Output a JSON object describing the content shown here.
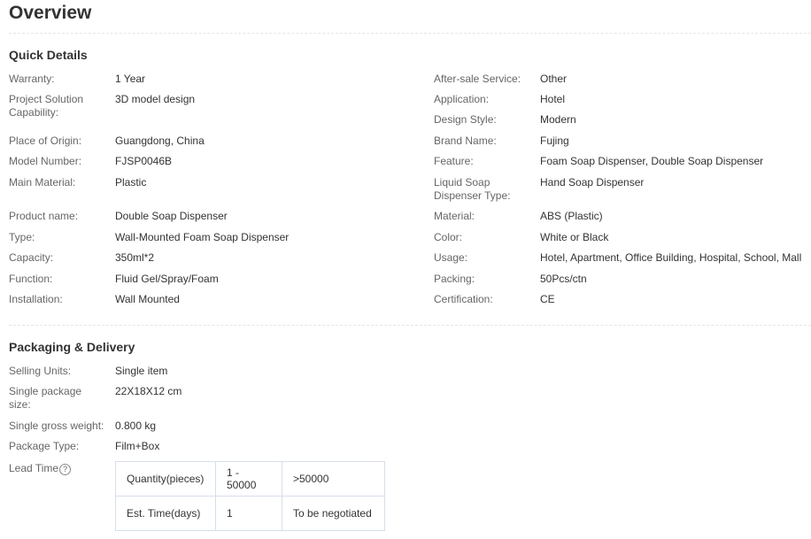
{
  "page": {
    "title": "Overview"
  },
  "quick_details": {
    "heading": "Quick Details",
    "left": [
      {
        "label": "Warranty:",
        "value": "1 Year"
      },
      {
        "label": "Project Solution Capability:",
        "value": "3D model design"
      },
      {
        "label": "Place of Origin:",
        "value": "Guangdong, China"
      },
      {
        "label": "Model Number:",
        "value": "FJSP0046B"
      },
      {
        "label": "Main Material:",
        "value": "Plastic"
      },
      {
        "label": "Product name:",
        "value": "Double Soap Dispenser"
      },
      {
        "label": "Type:",
        "value": "Wall-Mounted Foam Soap Dispenser"
      },
      {
        "label": "Capacity:",
        "value": "350ml*2"
      },
      {
        "label": "Function:",
        "value": "Fluid Gel/Spray/Foam"
      },
      {
        "label": "Installation:",
        "value": "Wall Mounted"
      }
    ],
    "right": [
      {
        "label": "After-sale Service:",
        "value": "Other"
      },
      {
        "label": "Application:",
        "value": "Hotel"
      },
      {
        "label": "Design Style:",
        "value": "Modern"
      },
      {
        "label": "Brand Name:",
        "value": "Fujing"
      },
      {
        "label": "Feature:",
        "value": "Foam Soap Dispenser, Double Soap Dispenser"
      },
      {
        "label": "Liquid Soap Dispenser Type:",
        "value": "Hand Soap Dispenser"
      },
      {
        "label": "Material:",
        "value": "ABS (Plastic)"
      },
      {
        "label": "Color:",
        "value": "White or Black"
      },
      {
        "label": "Usage:",
        "value": "Hotel, Apartment, Office Building, Hospital, School, Mall"
      },
      {
        "label": "Packing:",
        "value": "50Pcs/ctn"
      },
      {
        "label": "Certification:",
        "value": "CE"
      }
    ]
  },
  "packaging": {
    "heading": "Packaging & Delivery",
    "items": [
      {
        "label": "Selling Units:",
        "value": "Single item"
      },
      {
        "label": "Single package size:",
        "value": "22X18X12 cm"
      },
      {
        "label": "Single gross weight:",
        "value": "0.800 kg"
      },
      {
        "label": "Package Type:",
        "value": "Film+Box"
      }
    ],
    "lead_time": {
      "label": "Lead Time",
      "help_icon": "question-circle-icon",
      "rows": [
        [
          "Quantity(pieces)",
          "1 - 50000",
          ">50000"
        ],
        [
          "Est. Time(days)",
          "1",
          "To be negotiated"
        ]
      ]
    }
  },
  "colors": {
    "text": "#333333",
    "label": "#666666",
    "divider": "#e6e6e6",
    "table_border": "#d7deea"
  }
}
